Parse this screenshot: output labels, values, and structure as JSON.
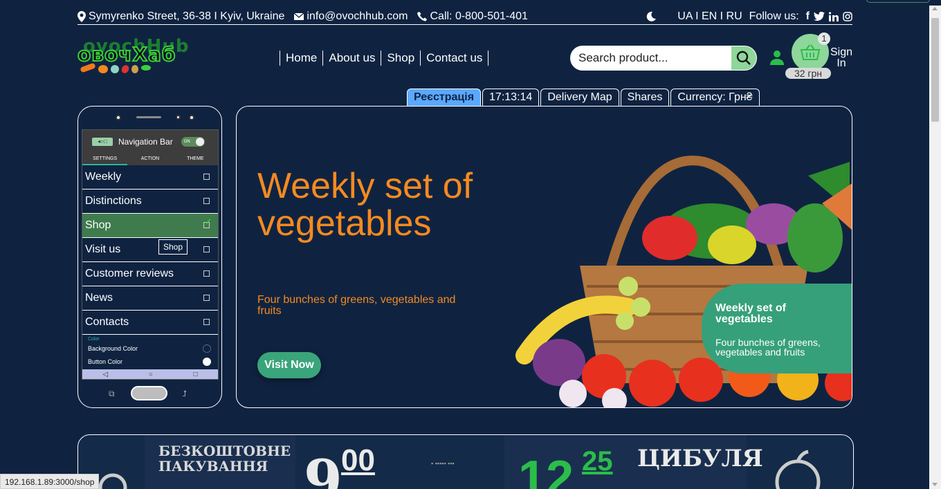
{
  "info": {
    "address": "Symyrenko Street, 36-38 I Kyiv, Ukraine",
    "email": "info@ovochhub.com",
    "phone": "Call: 0-800-501-401",
    "languages": "UA I EN I RU",
    "follow": "Follow us:"
  },
  "logo": {
    "ghost": "ovochHub",
    "main": "овочХаб"
  },
  "nav": {
    "home": "Home",
    "about": "About us",
    "shop": "Shop",
    "contact": "Contact us"
  },
  "search": {
    "placeholder": "Search product..."
  },
  "cart": {
    "count": "1",
    "price": "32 грн"
  },
  "signin": "Sign In",
  "tabs": [
    "Реєстрація",
    "17:13:14",
    "Delivery Map",
    "Shares",
    "Currency: Грн₴"
  ],
  "phone": {
    "navbar_title": "Navigation Bar",
    "toggle": "ON",
    "subtabs": [
      "SETTINGS",
      "ACTION",
      "THEME"
    ],
    "menu": [
      "Weekly",
      "Distinctions",
      "Shop",
      "Visit us",
      "Customer reviews",
      "News",
      "Contacts"
    ],
    "tooltip": "Shop",
    "color_label": "Color",
    "bg_color": "Background Color",
    "btn_color": "Button Color"
  },
  "hero": {
    "title": "Weekly set of vegetables",
    "subtitle": "Four bunches of greens, vegetables and fruits",
    "cta": "Visit Now",
    "card_title": "Weekly set of vegetables",
    "card_text": "Four bunches of greens, vegetables and fruits"
  },
  "banner": {
    "free_pack": "БЕЗКОШТОВНЕ ПАКУВАННЯ",
    "price1_int": "9",
    "price1_dec": "00",
    "price2_int": "12",
    "price2_dec": "25",
    "onion": "ЦИБУЛЯ"
  },
  "status_url": "192.168.1.89:3000/shop",
  "colors": {
    "bg": "#0f2341",
    "accent_green": "#3aa47a",
    "orange": "#f58a1f",
    "active_tab": "#5aa8ff"
  }
}
